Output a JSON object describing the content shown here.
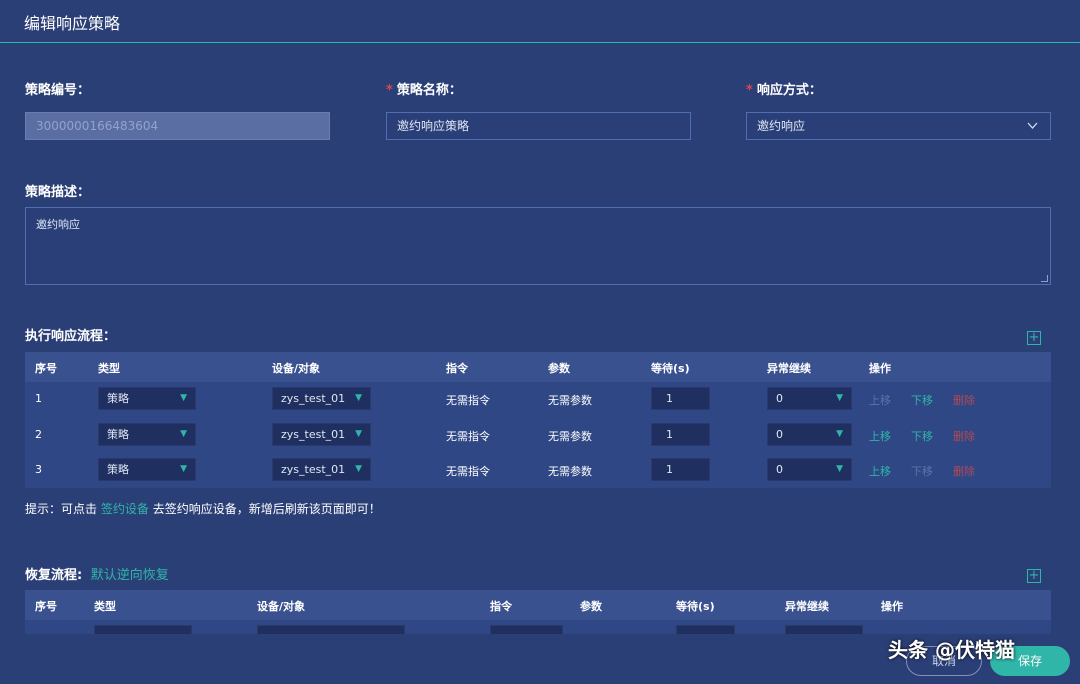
{
  "dialog": {
    "title": "编辑响应策略"
  },
  "form": {
    "id_label": "策略编号：",
    "id_value": "3000000166483604",
    "name_label": "策略名称：",
    "name_value": "邀约响应策略",
    "mode_label": "响应方式：",
    "mode_value": "邀约响应",
    "required_mark": "*",
    "desc_label": "策略描述：",
    "desc_value": "邀约响应"
  },
  "exec_flow": {
    "title": "执行响应流程：",
    "headers": [
      "序号",
      "类型",
      "设备/对象",
      "指令",
      "参数",
      "等待(s)",
      "异常继续",
      "操作"
    ],
    "rows": [
      {
        "no": "1",
        "type": "策略",
        "device": "zys_test_01",
        "command": "无需指令",
        "params": "无需参数",
        "wait": "1",
        "on_error": "0"
      },
      {
        "no": "2",
        "type": "策略",
        "device": "zys_test_01",
        "command": "无需指令",
        "params": "无需参数",
        "wait": "1",
        "on_error": "0"
      },
      {
        "no": "3",
        "type": "策略",
        "device": "zys_test_01",
        "command": "无需指令",
        "params": "无需参数",
        "wait": "1",
        "on_error": "0"
      }
    ],
    "ops": {
      "up": "上移",
      "down": "下移",
      "delete": "删除"
    }
  },
  "tip": {
    "prefix": "提示：可点击",
    "link": "签约设备",
    "suffix": "去签约响应设备，新增后刷新该页面即可！"
  },
  "recover_flow": {
    "title": "恢复流程:",
    "default_link": "默认逆向恢复",
    "headers": [
      "序号",
      "类型",
      "设备/对象",
      "指令",
      "参数",
      "等待(s)",
      "异常继续",
      "操作"
    ]
  },
  "actions": {
    "cancel": "取消",
    "save": "保存"
  },
  "watermark": "头条 @伏特猫",
  "icons": {
    "add": "plus-square-icon",
    "dropdown": "chevron-down-icon",
    "select_arrow": "triangle-down-icon"
  },
  "colors": {
    "background": "#2b3f77",
    "accent": "#2fb6a8",
    "danger": "#e0474c"
  }
}
